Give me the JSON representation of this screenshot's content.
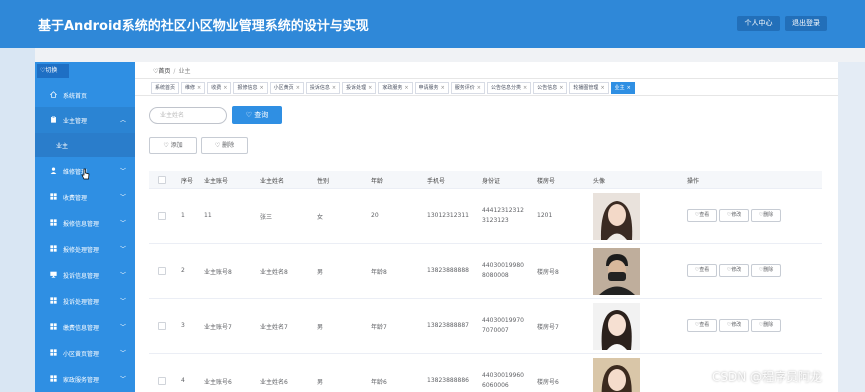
{
  "header": {
    "title": "基于Android系统的社区小区物业管理系统的设计与实现",
    "personal_center": "个人中心",
    "logout": "退出登录"
  },
  "sidebar": {
    "toggle_label": "切换",
    "items": [
      {
        "label": "系统首页",
        "icon": "home-icon",
        "chevron": ""
      },
      {
        "label": "业主管理",
        "icon": "clipboard-icon",
        "chevron": "︿"
      },
      {
        "label": "维修管理",
        "icon": "user-icon",
        "chevron": "﹀"
      },
      {
        "label": "收费管理",
        "icon": "grid-icon",
        "chevron": "﹀"
      },
      {
        "label": "报修信息管理",
        "icon": "grid-icon",
        "chevron": "﹀"
      },
      {
        "label": "报修处理管理",
        "icon": "grid-icon",
        "chevron": "﹀"
      },
      {
        "label": "投诉信息管理",
        "icon": "monitor-icon",
        "chevron": "﹀"
      },
      {
        "label": "投诉处理管理",
        "icon": "grid-icon",
        "chevron": "﹀"
      },
      {
        "label": "缴费信息管理",
        "icon": "grid-icon",
        "chevron": "﹀"
      },
      {
        "label": "小区黄页管理",
        "icon": "grid-icon",
        "chevron": "﹀"
      },
      {
        "label": "家政服务管理",
        "icon": "grid-icon",
        "chevron": "﹀"
      }
    ],
    "submenu": {
      "label": "业主"
    }
  },
  "breadcrumb": {
    "home": "首页",
    "current": "业主"
  },
  "tabs": [
    {
      "label": "系统首页"
    },
    {
      "label": "维修"
    },
    {
      "label": "收费"
    },
    {
      "label": "报修信息"
    },
    {
      "label": "小区黄页"
    },
    {
      "label": "投诉信息"
    },
    {
      "label": "投诉处理"
    },
    {
      "label": "家政服务"
    },
    {
      "label": "申请服务"
    },
    {
      "label": "服务评价"
    },
    {
      "label": "公告信息分类"
    },
    {
      "label": "公告信息"
    },
    {
      "label": "轮播图管理"
    },
    {
      "label": "业主"
    }
  ],
  "search": {
    "placeholder": "业主姓名",
    "button": "查询"
  },
  "actions": {
    "add": "添加",
    "delete": "删除"
  },
  "table": {
    "columns": [
      "序号",
      "业主账号",
      "业主姓名",
      "性别",
      "年龄",
      "手机号",
      "身份证",
      "楼房号",
      "头像",
      "操作"
    ],
    "rows": [
      {
        "index": "1",
        "account": "11",
        "name": "张三",
        "gender": "女",
        "age": "20",
        "phone": "13012312311",
        "id_line1": "44412312312",
        "id_line2": "3123123",
        "building": "1201"
      },
      {
        "index": "2",
        "account": "业主账号8",
        "name": "业主姓名8",
        "gender": "男",
        "age": "年龄8",
        "phone": "13823888888",
        "id_line1": "44030019980",
        "id_line2": "8080008",
        "building": "楼房号8"
      },
      {
        "index": "3",
        "account": "业主账号7",
        "name": "业主姓名7",
        "gender": "男",
        "age": "年龄7",
        "phone": "13823888887",
        "id_line1": "44030019970",
        "id_line2": "7070007",
        "building": "楼房号7"
      },
      {
        "index": "4",
        "account": "业主账号6",
        "name": "业主姓名6",
        "gender": "男",
        "age": "年龄6",
        "phone": "13823888886",
        "id_line1": "44030019960",
        "id_line2": "6060006",
        "building": "楼房号6"
      }
    ],
    "op_view": "查看",
    "op_edit": "修改",
    "op_delete": "删除"
  },
  "watermark": "CSDN @程序员阿龙",
  "colors": {
    "header": "#2f88d8",
    "sidebar": "#2f8fe3",
    "primary": "#2f8fe3"
  }
}
